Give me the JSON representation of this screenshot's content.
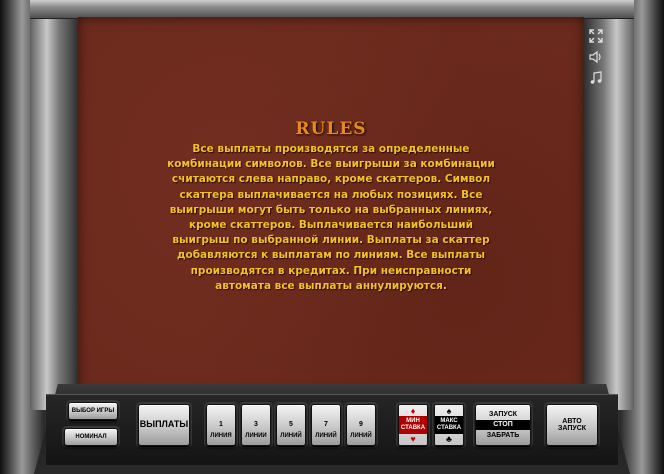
{
  "screen": {
    "title": "RULES",
    "text": "Все выплаты производятся за определенные\nкомбинации символов. Все выигрыши за комбинации\nсчитаются слева направо, кроме скаттеров. Символ\nскаттера выплачивается на любых позициях. Все\nвыигрыши могут быть только на выбранных линиях,\nкроме скаттеров. Выплачивается наибольший\nвыигрыш по выбранной линии. Выплаты за скаттер\nдобавляются к выплатам по линиям. Все выплаты\nпроизводятся в кредитах. При неисправности\nавтомата все выплаты аннулируются.",
    "colors": {
      "background": "#6b2a1d",
      "title": "#e78a1c",
      "text": "#f2c228"
    }
  },
  "side_icons": [
    "fullscreen-icon",
    "sound-icon",
    "music-icon"
  ],
  "controls": {
    "select_game": "ВЫБОР ИГРЫ",
    "denomination": "НОМИНАЛ",
    "payouts": "ВЫПЛАТЫ",
    "lines": [
      {
        "num": "1",
        "label": "ЛИНИЯ"
      },
      {
        "num": "3",
        "label": "ЛИНИИ"
      },
      {
        "num": "5",
        "label": "ЛИНИЙ"
      },
      {
        "num": "7",
        "label": "ЛИНИЙ"
      },
      {
        "num": "9",
        "label": "ЛИНИЙ"
      }
    ],
    "min_bet": "МИН СТАВКА",
    "max_bet": "МАКС СТАВКА",
    "start": "ЗАПУСК",
    "stop": "СТОП",
    "take": "ЗАБРАТЬ",
    "auto_start": "АВТО ЗАПУСК"
  }
}
